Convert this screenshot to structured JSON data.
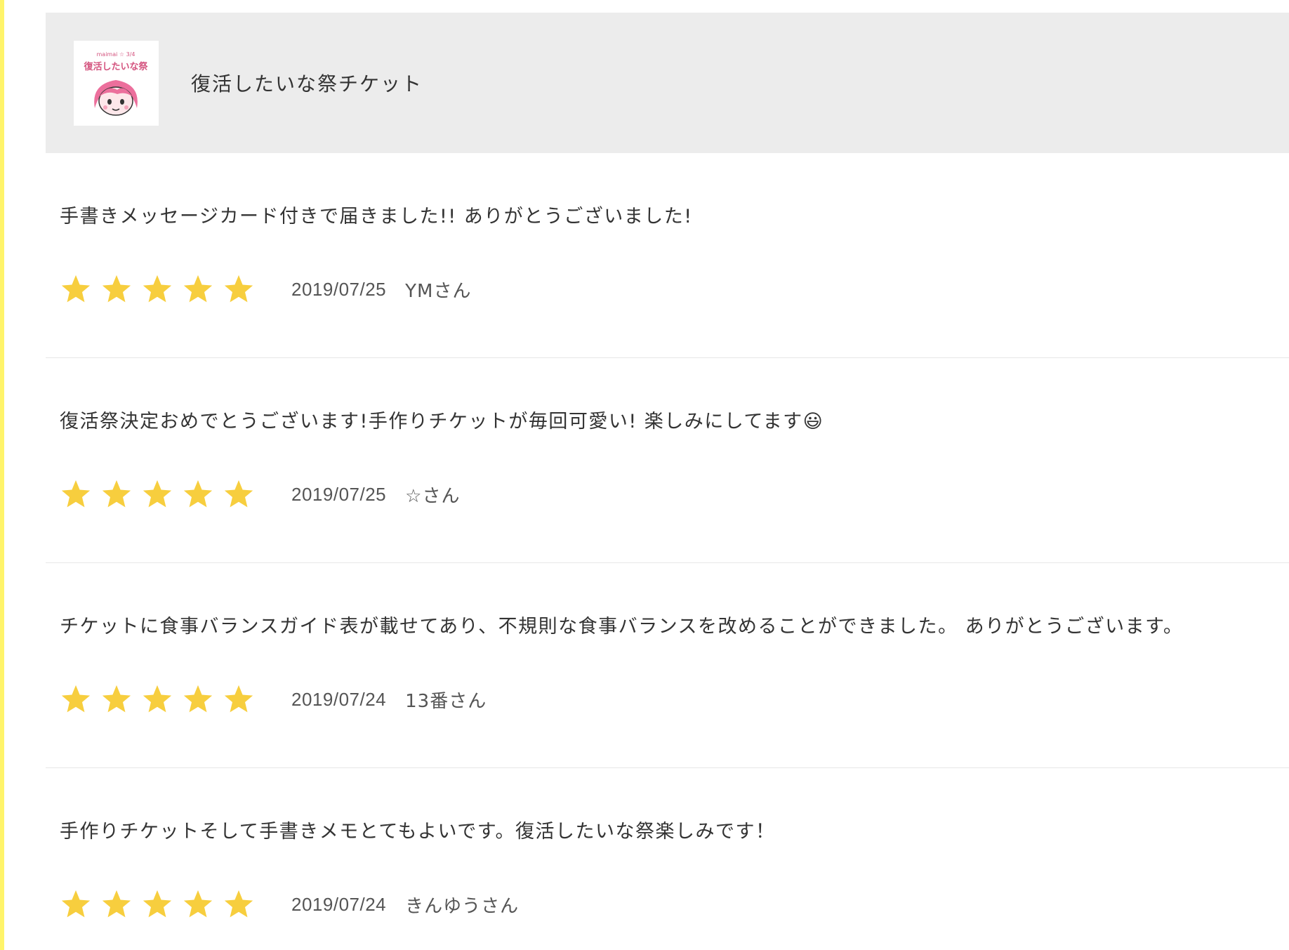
{
  "product": {
    "title": "復活したいな祭チケット",
    "thumbnail_icon": "pink-haired-girl-mascot-logo",
    "thumbnail_caption_top": "maimai ☆ 3/4",
    "thumbnail_caption": "復活したいな祭"
  },
  "colors": {
    "star": "#f7ce3e",
    "header_bg": "#ececec",
    "left_edge": "#fff46a",
    "mascot_hair": "#ec6f9c"
  },
  "reviews": [
    {
      "text": "手書きメッセージカード付きで届きました!! ありがとうございました!",
      "rating": 5,
      "date": "2019/07/25",
      "author": "YMさん"
    },
    {
      "text": "復活祭決定おめでとうございます!手作りチケットが毎回可愛い! 楽しみにしてます😃",
      "rating": 5,
      "date": "2019/07/25",
      "author": "☆さん"
    },
    {
      "text": "チケットに食事バランスガイド表が載せてあり、不規則な食事バランスを改めることができました。 ありがとうございます。",
      "rating": 5,
      "date": "2019/07/24",
      "author": "13番さん"
    },
    {
      "text": "手作りチケットそして手書きメモとてもよいです。復活したいな祭楽しみです！",
      "rating": 5,
      "date": "2019/07/24",
      "author": "きんゆうさん"
    }
  ]
}
